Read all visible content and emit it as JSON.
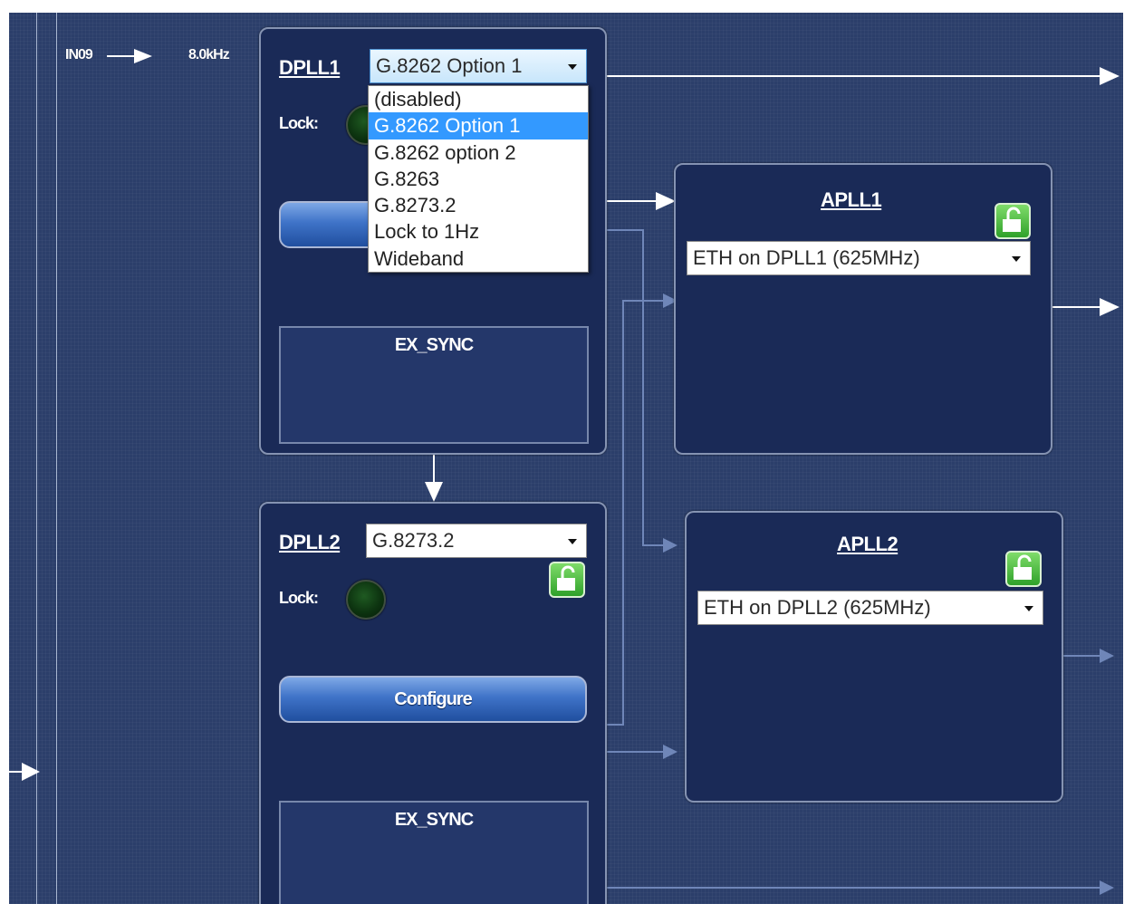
{
  "input": {
    "name": "IN09",
    "frequency": "8.0kHz"
  },
  "dpll1": {
    "title": "DPLL1",
    "selected": "G.8262 Option 1",
    "lock_label": "Lock:",
    "exsync_label": "EX_SYNC",
    "options": [
      "(disabled)",
      "G.8262 Option 1",
      "G.8262 option 2",
      "G.8263",
      "G.8273.2",
      "Lock to 1Hz",
      "Wideband"
    ],
    "selected_index": 1,
    "dropdown_open": true
  },
  "dpll2": {
    "title": "DPLL2",
    "selected": "G.8273.2",
    "lock_label": "Lock:",
    "configure_label": "Configure",
    "exsync_label": "EX_SYNC"
  },
  "apll1": {
    "title": "APLL1",
    "selected": "ETH on DPLL1 (625MHz)"
  },
  "apll2": {
    "title": "APLL2",
    "selected": "ETH on DPLL2 (625MHz)"
  },
  "colors": {
    "background": "#2b3e6a",
    "panel": "#1a2a57",
    "selection": "#3399ff",
    "unlock_icon": "#3fb531",
    "wire_active": "#ffffff",
    "wire_inactive": "#6f86b8"
  },
  "icons": [
    "unlock-icon",
    "led-icon",
    "arrow-right-icon",
    "arrow-down-icon",
    "chevron-down-icon"
  ]
}
